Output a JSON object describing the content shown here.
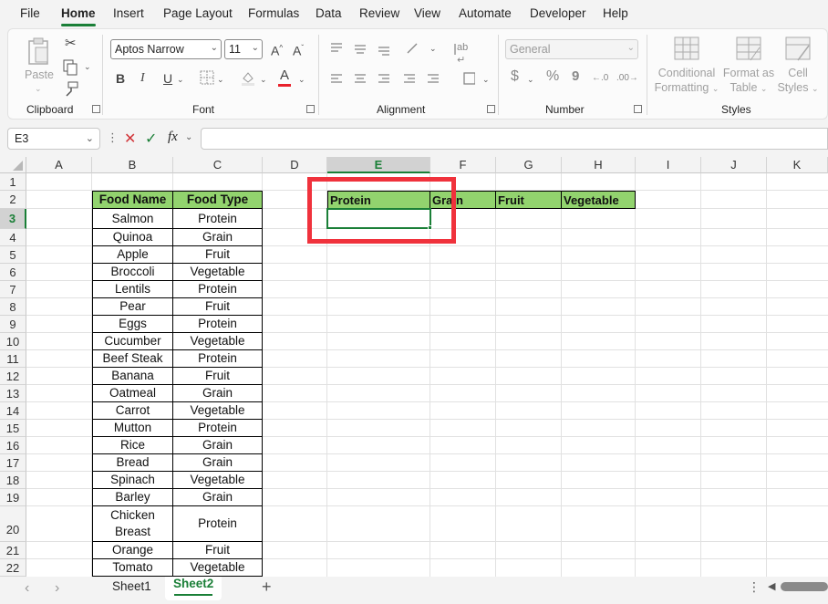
{
  "menu": [
    "File",
    "Home",
    "Insert",
    "Page Layout",
    "Formulas",
    "Data",
    "Review",
    "View",
    "Automate",
    "Developer",
    "Help"
  ],
  "ribbon": {
    "clipboard": {
      "paste_label": "Paste",
      "group_label": "Clipboard"
    },
    "font": {
      "font_name": "Aptos Narrow",
      "font_size": "11",
      "group_label": "Font",
      "bold": "B",
      "italic": "I",
      "underline": "U",
      "grow": "A^",
      "shrink": "Aˇ",
      "font_color": "A"
    },
    "alignment": {
      "group_label": "Alignment"
    },
    "number": {
      "format": "General",
      "group_label": "Number",
      "currency": "$",
      "percent": "%",
      "comma": "9"
    },
    "styles": {
      "conditional_l1": "Conditional",
      "conditional_l2": "Formatting",
      "format_table_l1": "Format as",
      "format_table_l2": "Table",
      "cell_styles_l1": "Cell",
      "cell_styles_l2": "Styles",
      "group_label": "Styles"
    }
  },
  "formula_bar": {
    "name_box": "E3",
    "fx": "fx",
    "value": ""
  },
  "columns": [
    "A",
    "B",
    "C",
    "D",
    "E",
    "F",
    "G",
    "H",
    "I",
    "J",
    "K"
  ],
  "rows": [
    "1",
    "2",
    "3",
    "4",
    "5",
    "6",
    "7",
    "8",
    "9",
    "10",
    "11",
    "12",
    "13",
    "14",
    "15",
    "16",
    "17",
    "18",
    "19",
    "20",
    "21",
    "22"
  ],
  "table": {
    "headers": [
      "Food Name",
      "Food Type"
    ],
    "rows": [
      [
        "Salmon",
        "Protein"
      ],
      [
        "Quinoa",
        "Grain"
      ],
      [
        "Apple",
        "Fruit"
      ],
      [
        "Broccoli",
        "Vegetable"
      ],
      [
        "Lentils",
        "Protein"
      ],
      [
        "Pear",
        "Fruit"
      ],
      [
        "Eggs",
        "Protein"
      ],
      [
        "Cucumber",
        "Vegetable"
      ],
      [
        "Beef Steak",
        "Protein"
      ],
      [
        "Banana",
        "Fruit"
      ],
      [
        "Oatmeal",
        "Grain"
      ],
      [
        "Carrot",
        "Vegetable"
      ],
      [
        "Mutton",
        "Protein"
      ],
      [
        "Rice",
        "Grain"
      ],
      [
        "Bread",
        "Grain"
      ],
      [
        "Spinach",
        "Vegetable"
      ],
      [
        "Barley",
        "Grain"
      ],
      [
        "Chicken Breast",
        "Protein"
      ],
      [
        "Orange",
        "Fruit"
      ],
      [
        "Tomato",
        "Vegetable"
      ]
    ]
  },
  "result_headers": [
    "Protein",
    "Grain",
    "Fruit",
    "Vegetable"
  ],
  "sheets": [
    "Sheet1",
    "Sheet2"
  ],
  "active_sheet": "Sheet2",
  "colors": {
    "header_green": "#92d36e",
    "accent_green": "#1a7f37",
    "highlight_red": "#f0323c"
  }
}
